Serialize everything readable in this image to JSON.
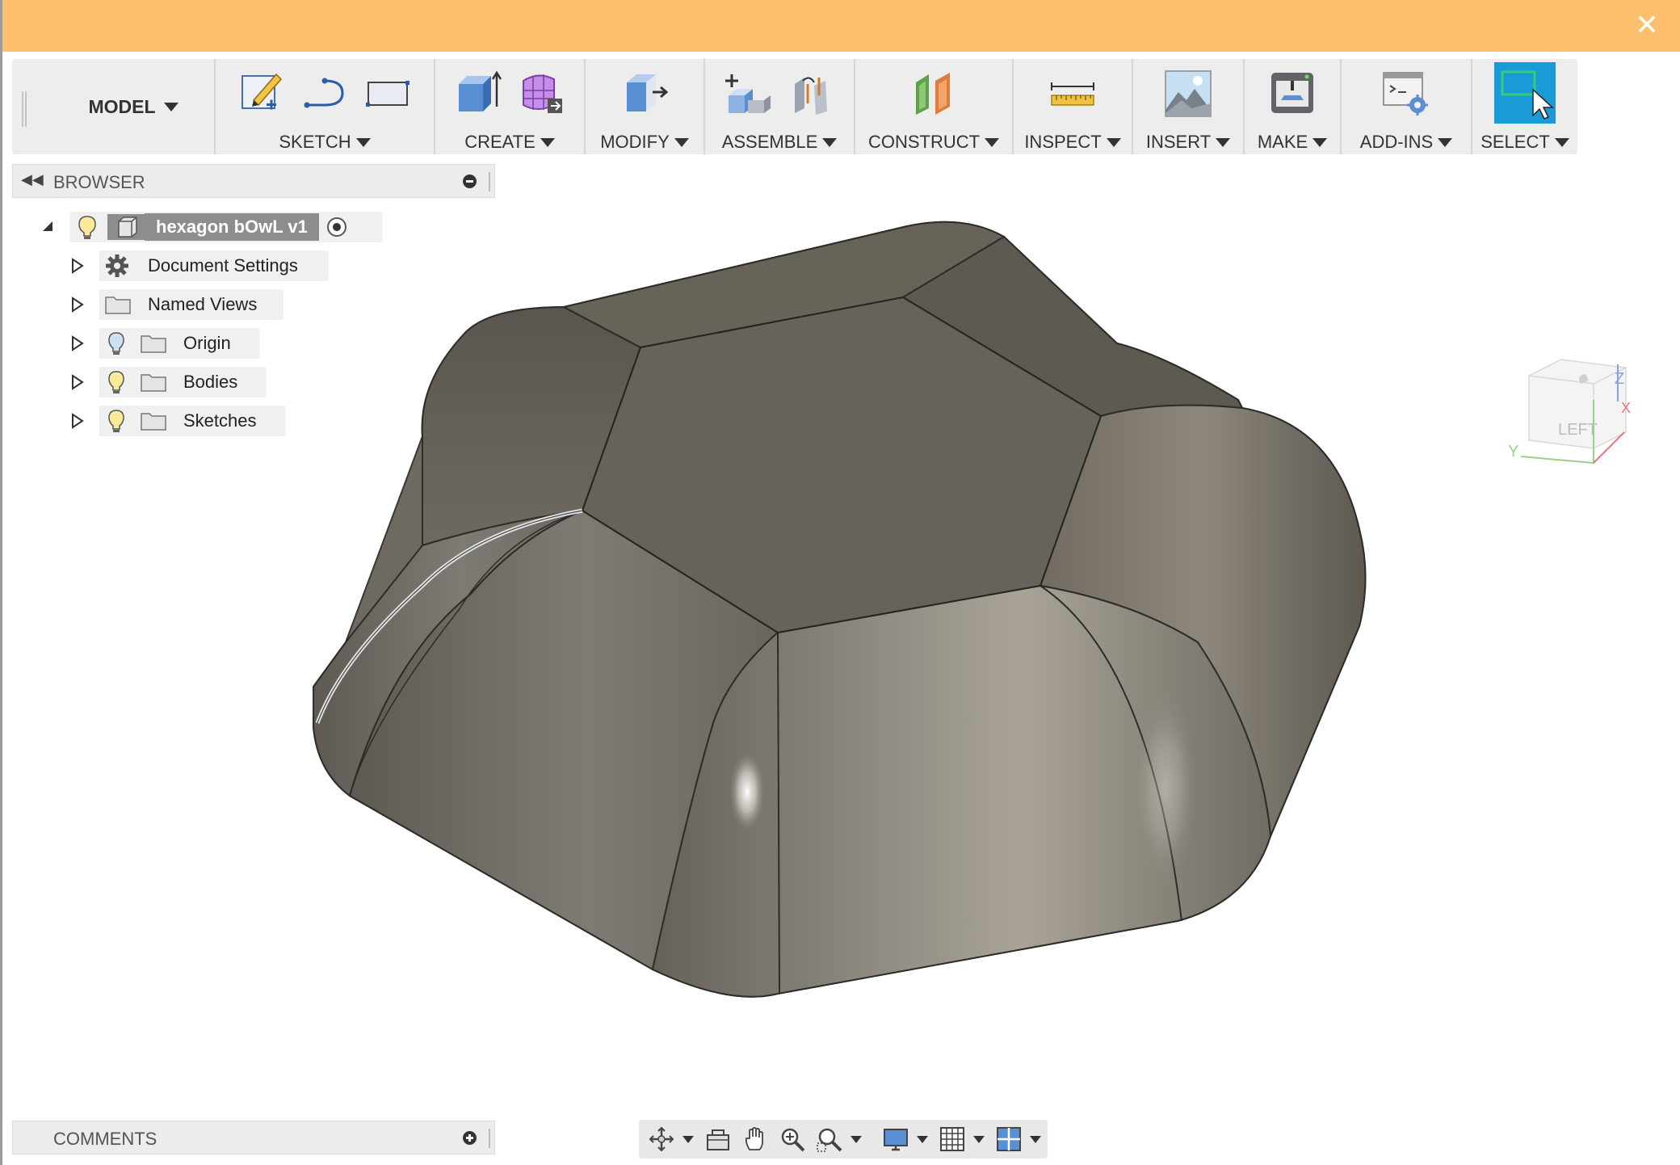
{
  "window": {
    "close_icon": "close-icon",
    "titlebar_color": "#fdbf6b"
  },
  "toolbar": {
    "workspace_label": "MODEL",
    "groups": [
      {
        "label": "SKETCH",
        "icons": [
          "create-sketch-icon",
          "line-arc-icon",
          "rectangle-icon"
        ]
      },
      {
        "label": "CREATE",
        "icons": [
          "extrude-box-icon",
          "form-grid-icon"
        ]
      },
      {
        "label": "MODIFY",
        "icons": [
          "press-pull-icon"
        ]
      },
      {
        "label": "ASSEMBLE",
        "icons": [
          "new-component-icon",
          "joint-icon"
        ]
      },
      {
        "label": "CONSTRUCT",
        "icons": [
          "offset-plane-icon"
        ]
      },
      {
        "label": "INSPECT",
        "icons": [
          "measure-icon"
        ]
      },
      {
        "label": "INSERT",
        "icons": [
          "insert-image-icon"
        ]
      },
      {
        "label": "MAKE",
        "icons": [
          "3d-print-icon"
        ]
      },
      {
        "label": "ADD-INS",
        "icons": [
          "scripts-addins-icon"
        ]
      },
      {
        "label": "SELECT",
        "icons": [
          "select-window-icon"
        ]
      }
    ]
  },
  "browser": {
    "title": "BROWSER",
    "root": {
      "label": "hexagon bOwL v1"
    },
    "items": [
      {
        "label": "Document Settings",
        "icon": "gear-icon"
      },
      {
        "label": "Named Views",
        "icon": "folder-icon"
      },
      {
        "label": "Origin",
        "icon": "folder-icon"
      },
      {
        "label": "Bodies",
        "icon": "folder-icon"
      },
      {
        "label": "Sketches",
        "icon": "folder-icon"
      }
    ]
  },
  "viewcube": {
    "face": "LEFT",
    "axis_labels": [
      "Z",
      "X",
      "Y"
    ]
  },
  "comments": {
    "title": "COMMENTS"
  },
  "navbar": {
    "icons": [
      "orbit-icon",
      "look-at-icon",
      "pan-icon",
      "zoom-icon",
      "zoom-window-icon",
      "display-settings-icon",
      "grid-icon",
      "viewports-icon"
    ]
  },
  "colors": {
    "accent": "#1a9ad6",
    "model": "#6f6b63"
  }
}
